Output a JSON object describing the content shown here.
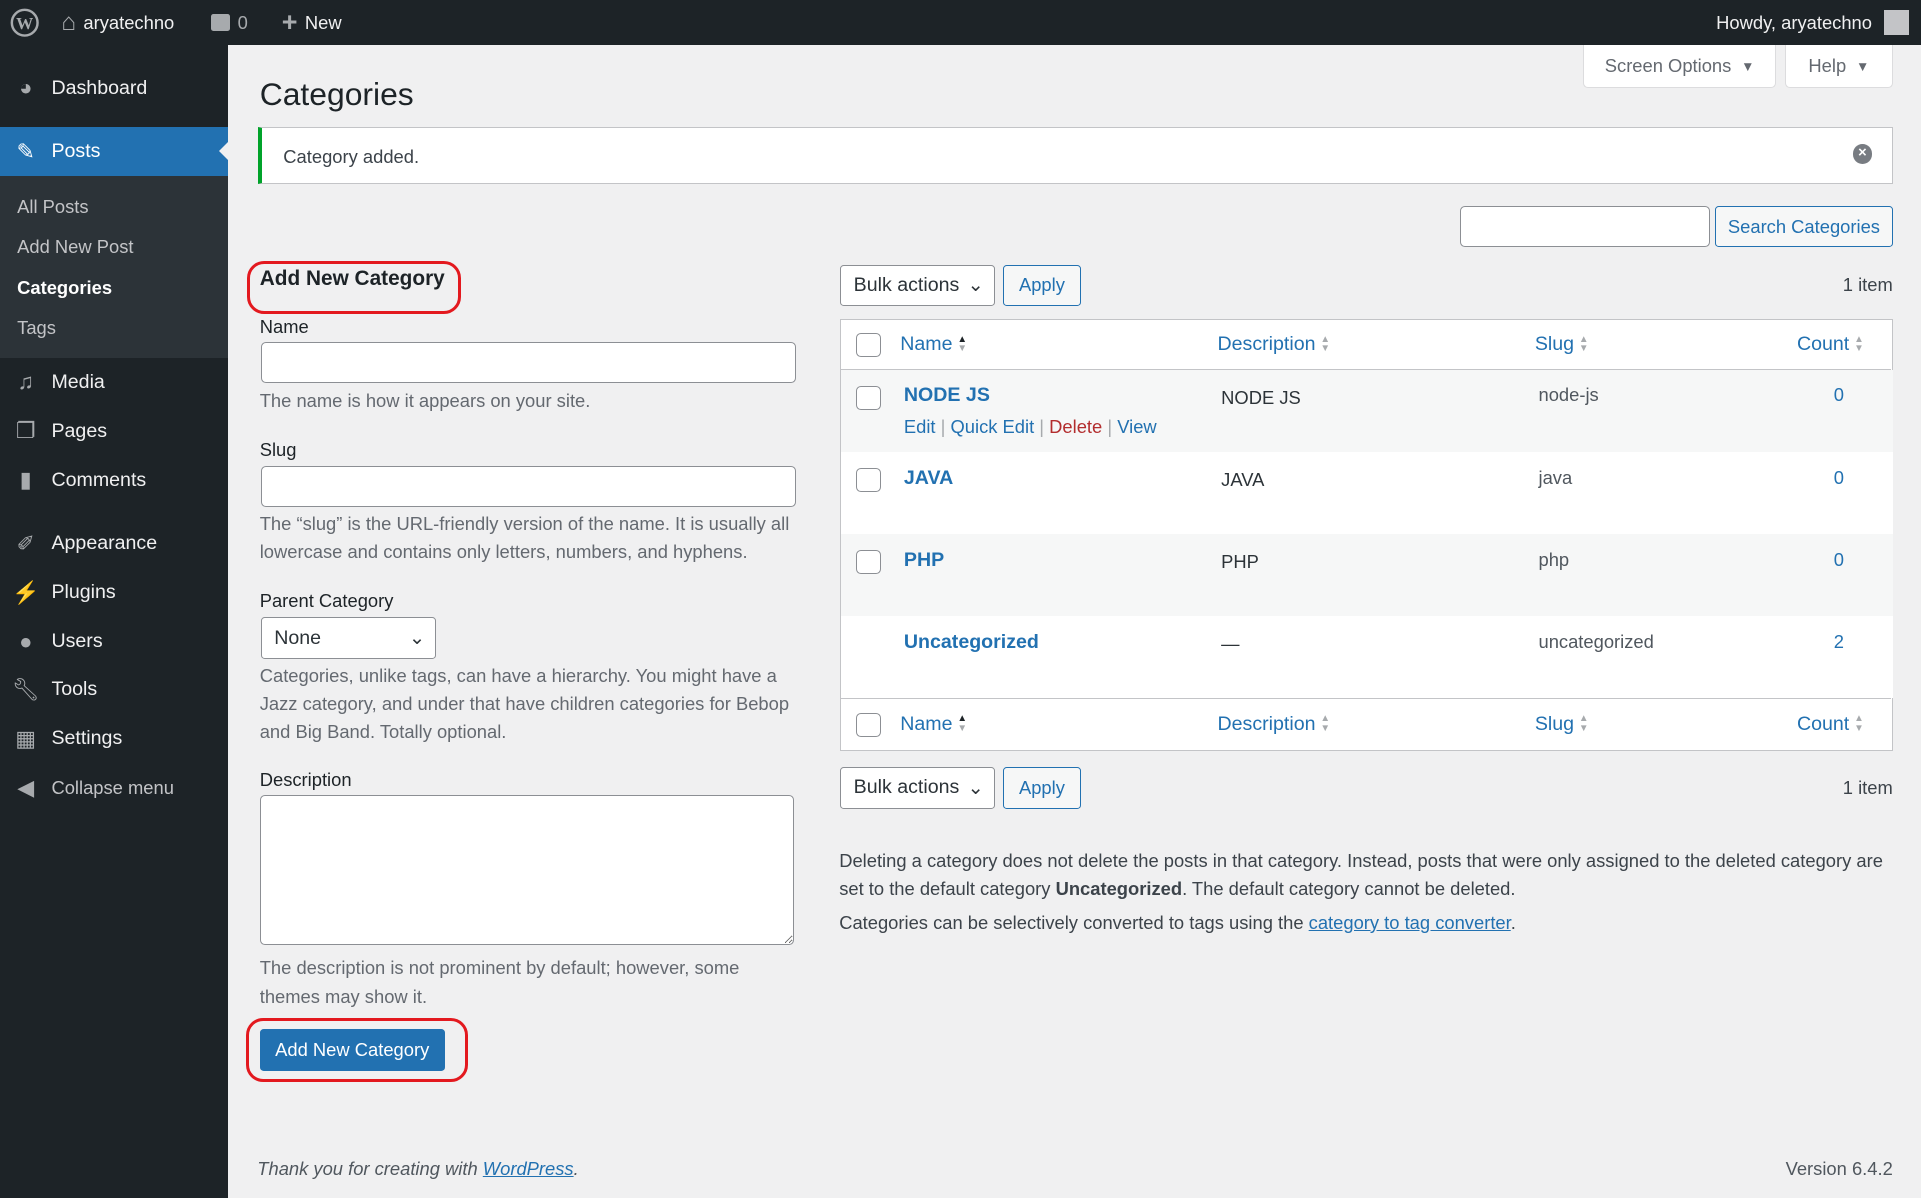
{
  "topbar": {
    "site": "aryatechno",
    "comments": "0",
    "new": "New",
    "howdy": "Howdy, aryatechno"
  },
  "sidebar": {
    "items": [
      {
        "label": "Dashboard",
        "icon": "dashboard-icon"
      },
      {
        "label": "Posts",
        "icon": "pin-icon"
      },
      {
        "label": "Media",
        "icon": "media-icon"
      },
      {
        "label": "Pages",
        "icon": "pages-icon"
      },
      {
        "label": "Comments",
        "icon": "comment-icon"
      },
      {
        "label": "Appearance",
        "icon": "brush-icon"
      },
      {
        "label": "Plugins",
        "icon": "plugin-icon"
      },
      {
        "label": "Users",
        "icon": "user-icon"
      },
      {
        "label": "Tools",
        "icon": "wrench-icon"
      },
      {
        "label": "Settings",
        "icon": "settings-icon"
      },
      {
        "label": "Collapse menu",
        "icon": "collapse-icon"
      }
    ],
    "submenu": [
      "All Posts",
      "Add New Post",
      "Categories",
      "Tags"
    ]
  },
  "header": {
    "title": "Categories",
    "screen_options": "Screen Options",
    "help": "Help"
  },
  "notice": {
    "text": "Category added."
  },
  "search": {
    "value": "",
    "button": "Search Categories"
  },
  "form": {
    "heading": "Add New Category",
    "name_label": "Name",
    "name_value": "",
    "name_hint": "The name is how it appears on your site.",
    "slug_label": "Slug",
    "slug_value": "",
    "slug_hint": "The “slug” is the URL-friendly version of the name. It is usually all lowercase and contains only letters, numbers, and hyphens.",
    "parent_label": "Parent Category",
    "parent_value": "None",
    "parent_hint": "Categories, unlike tags, can have a hierarchy. You might have a Jazz category, and under that have children categories for Bebop and Big Band. Totally optional.",
    "desc_label": "Description",
    "desc_value": "",
    "desc_hint": "The description is not prominent by default; however, some themes may show it.",
    "submit": "Add New Category"
  },
  "table": {
    "bulk": "Bulk actions",
    "apply": "Apply",
    "count_text": "1 item",
    "columns": [
      "Name",
      "Description",
      "Slug",
      "Count"
    ],
    "rows": [
      {
        "name": "NODE JS",
        "description": "NODE JS",
        "slug": "node-js",
        "count": "0"
      },
      {
        "name": "JAVA",
        "description": "JAVA",
        "slug": "java",
        "count": "0"
      },
      {
        "name": "PHP",
        "description": "PHP",
        "slug": "php",
        "count": "0"
      },
      {
        "name": "Uncategorized",
        "description": "—",
        "slug": "uncategorized",
        "count": "2"
      }
    ],
    "row_actions": [
      "Edit",
      "Quick Edit",
      "Delete",
      "View"
    ]
  },
  "notes": {
    "p1a": "Deleting a category does not delete the posts in that category. Instead, posts that were only assigned to the deleted category are set to the default category ",
    "p1b": "Uncategorized",
    "p1c": ". The default category cannot be deleted.",
    "p2a": "Categories can be selectively converted to tags using the ",
    "p2link": "category to tag converter",
    "p2b": "."
  },
  "footer": {
    "thanks": "Thank you for creating with ",
    "wp": "WordPress",
    "version": "Version 6.4.2"
  },
  "colors": {
    "accent": "#2271b1",
    "sidebar": "#1d2327",
    "notice_success": "#00a32a",
    "delete": "#b32d2e",
    "highlight": "#e3191f"
  }
}
